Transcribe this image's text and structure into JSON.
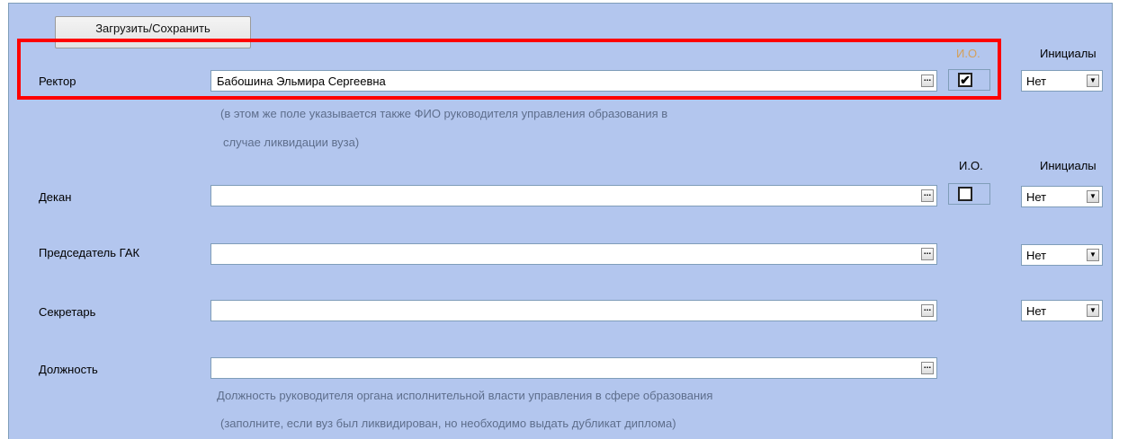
{
  "toolbar": {
    "load_save_label": "Загрузить/Сохранить"
  },
  "headers": {
    "io_label": "И.О.",
    "initials_label": "Инициалы"
  },
  "rows": {
    "rector": {
      "label": "Ректор",
      "value": "Бабошина Эльмира Сергеевна",
      "io_checked": "✔",
      "initials": "Нет",
      "hint": [
        "(в этом же поле указывается также ФИО руководителя управления образования в",
        "случае ликвидации вуза)"
      ]
    },
    "dean": {
      "label": "Декан",
      "value": "",
      "io_checked": "",
      "initials": "Нет"
    },
    "chairman": {
      "label": "Председатель ГАК",
      "value": "",
      "initials": "Нет"
    },
    "secretary": {
      "label": "Секретарь",
      "value": "",
      "initials": "Нет"
    },
    "position": {
      "label": "Должность",
      "value": "",
      "hint": [
        "Должность руководителя органа исполнительной власти управления в сфере образования",
        "(заполните, если вуз был ликвидирован, но необходимо выдать дубликат диплома)"
      ]
    }
  },
  "icons": {
    "ellipsis": "ellipsis-icon",
    "dropdown": "chevron-down-icon",
    "checkbox": "checkbox-icon"
  },
  "colors": {
    "panel": "#b3c6ee",
    "highlight": "#ff0000",
    "io_header_active": "#d4a05a",
    "hint_text": "#5e6e8c"
  }
}
